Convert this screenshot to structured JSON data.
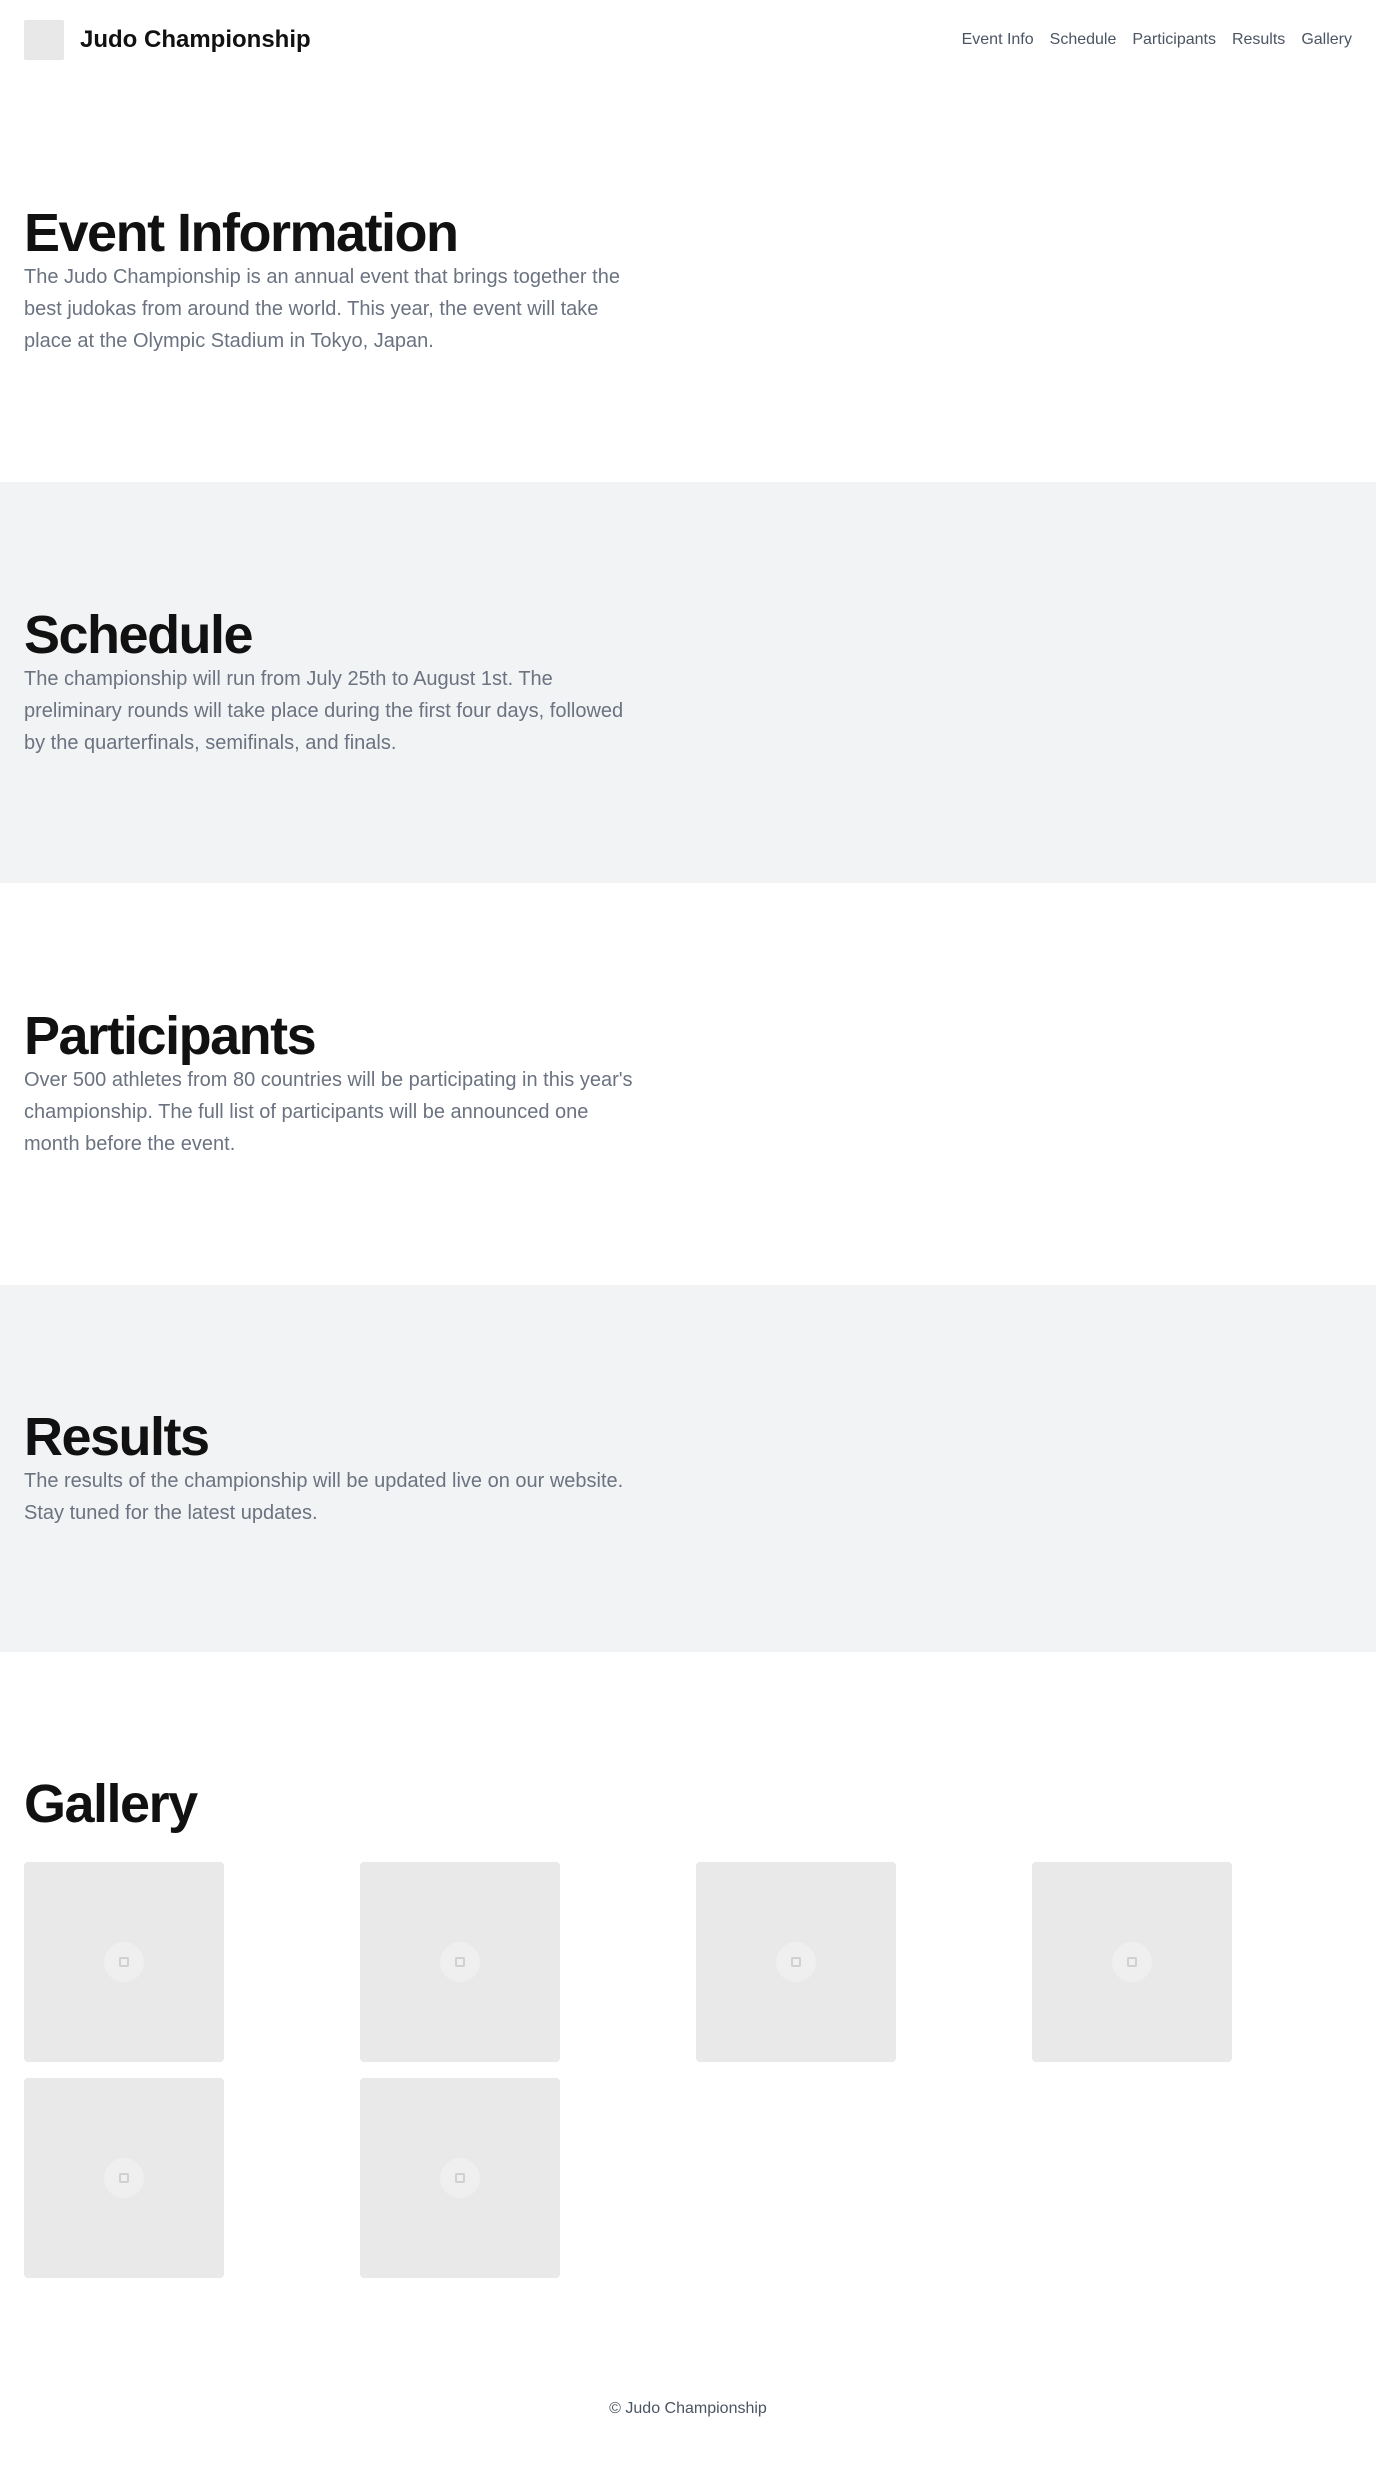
{
  "header": {
    "title": "Judo Championship",
    "logo_icon": "logo-placeholder-icon",
    "nav": [
      {
        "label": "Event Info"
      },
      {
        "label": "Schedule"
      },
      {
        "label": "Participants"
      },
      {
        "label": "Results"
      },
      {
        "label": "Gallery"
      }
    ]
  },
  "sections": {
    "event": {
      "heading": "Event Information",
      "body": "The Judo Championship is an annual event that brings together the best judokas from around the world. This year, the event will take place at the Olympic Stadium in Tokyo, Japan."
    },
    "schedule": {
      "heading": "Schedule",
      "body": "The championship will run from July 25th to August 1st. The preliminary rounds will take place during the first four days, followed by the quarterfinals, semifinals, and finals."
    },
    "participants": {
      "heading": "Participants",
      "body": "Over 500 athletes from 80 countries will be participating in this year's championship. The full list of participants will be announced one month before the event."
    },
    "results": {
      "heading": "Results",
      "body": "The results of the championship will be updated live on our website. Stay tuned for the latest updates."
    }
  },
  "gallery": {
    "heading": "Gallery",
    "image_icon": "image-placeholder-icon",
    "image_count": 6
  },
  "footer": {
    "text": "© Judo Championship"
  },
  "colors": {
    "alt_section_bg": "#f2f3f5",
    "body_text": "#6b7280",
    "nav_text": "#4b5563"
  }
}
